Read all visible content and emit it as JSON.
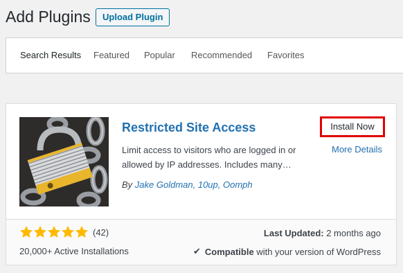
{
  "header": {
    "title": "Add Plugins",
    "upload_label": "Upload Plugin"
  },
  "tabs": [
    {
      "label": "Search Results",
      "active": true
    },
    {
      "label": "Featured"
    },
    {
      "label": "Popular"
    },
    {
      "label": "Recommended"
    },
    {
      "label": "Favorites"
    }
  ],
  "plugin": {
    "name": "Restricted Site Access",
    "install_label": "Install Now",
    "more_details_label": "More Details",
    "description": "Limit access to visitors who are logged in or allowed by IP addresses. Includes many…",
    "author_prefix": "By",
    "author": "Jake Goldman, 10up, Oomph",
    "rating_stars": 5,
    "rating_count": "(42)",
    "active_installs": "20,000+ Active Installations",
    "last_updated_label": "Last Updated:",
    "last_updated_value": "2 months ago",
    "compat_strong": "Compatible",
    "compat_rest": "with your version of WordPress",
    "thumbnail_icon": "padlock-on-chains-image"
  },
  "colors": {
    "link": "#2271b1",
    "star": "#ffb900",
    "highlight_border": "#e00000"
  }
}
